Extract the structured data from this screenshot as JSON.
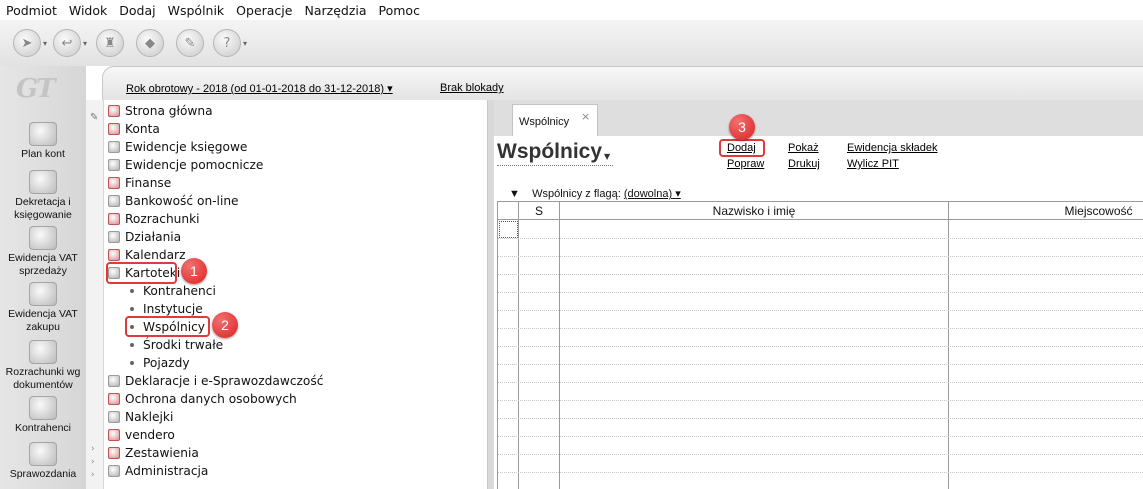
{
  "menu": [
    "Podmiot",
    "Widok",
    "Dodaj",
    "Wspólnik",
    "Operacje",
    "Narzędzia",
    "Pomoc"
  ],
  "toolbar": {
    "icons": [
      "send-icon",
      "receive-icon",
      "stamp-icon",
      "label-icon",
      "tools-icon",
      "help-icon"
    ]
  },
  "logo": "GT",
  "leftbar": {
    "items": [
      {
        "label": "Plan kont",
        "icon": "chart-of-accounts-icon"
      },
      {
        "label": "Dekretacja i księgowanie",
        "icon": "posting-icon"
      },
      {
        "label": "Ewidencja VAT sprzedaży",
        "icon": "vat-sales-icon"
      },
      {
        "label": "Ewidencja VAT zakupu",
        "icon": "vat-purchase-icon"
      },
      {
        "label": "Rozrachunki wg dokumentów",
        "icon": "settlements-icon"
      },
      {
        "label": "Kontrahenci",
        "icon": "contractors-icon"
      },
      {
        "label": "Sprawozdania",
        "icon": "reports-icon"
      }
    ]
  },
  "header": {
    "fiscal_year": "Rok obrotowy - 2018  (od 01-01-2018 do 31-12-2018)",
    "lock_status": "Brak blokady"
  },
  "tree": {
    "nodes": [
      {
        "label": "Strona główna",
        "icon": "home-icon"
      },
      {
        "label": "Konta",
        "icon": "accounts-icon"
      },
      {
        "label": "Ewidencje księgowe",
        "icon": "ledger-icon"
      },
      {
        "label": "Ewidencje pomocnicze",
        "icon": "auxiliary-records-icon"
      },
      {
        "label": "Finanse",
        "icon": "finance-icon"
      },
      {
        "label": "Bankowość on-line",
        "icon": "banking-icon"
      },
      {
        "label": "Rozrachunki",
        "icon": "settlements-icon"
      },
      {
        "label": "Działania",
        "icon": "actions-icon"
      },
      {
        "label": "Kalendarz",
        "icon": "calendar-icon"
      },
      {
        "label": "Kartoteki",
        "icon": "records-icon"
      }
    ],
    "subitems": [
      "Kontrahenci",
      "Instytucje",
      "Wspólnicy",
      "Środki trwałe",
      "Pojazdy"
    ],
    "nodes_after": [
      {
        "label": "Deklaracje i e-Sprawozdawczość",
        "icon": "declarations-icon"
      },
      {
        "label": "Ochrona danych osobowych",
        "icon": "data-protection-icon"
      },
      {
        "label": "Naklejki",
        "icon": "stickers-icon"
      },
      {
        "label": "vendero",
        "icon": "vendero-icon"
      },
      {
        "label": "Zestawienia",
        "icon": "summaries-icon"
      },
      {
        "label": "Administracja",
        "icon": "administration-icon"
      }
    ]
  },
  "badges": [
    "1",
    "2",
    "3"
  ],
  "tab": {
    "label": "Wspólnicy",
    "close": "×"
  },
  "page": {
    "title": "Wspólnicy",
    "actions": {
      "add": "Dodaj",
      "show": "Pokaż",
      "contributions": "Ewidencja składek",
      "edit": "Popraw",
      "print": "Drukuj",
      "calc_pit": "Wylicz PIT"
    },
    "filter_label": "Wspólnicy z flagą:",
    "filter_value": "(dowolna)"
  },
  "grid": {
    "columns": [
      "",
      "S",
      "Nazwisko i imię",
      "Miejscowość"
    ]
  },
  "colors": {
    "highlight": "#e03a3a",
    "badge": "#d22222"
  }
}
